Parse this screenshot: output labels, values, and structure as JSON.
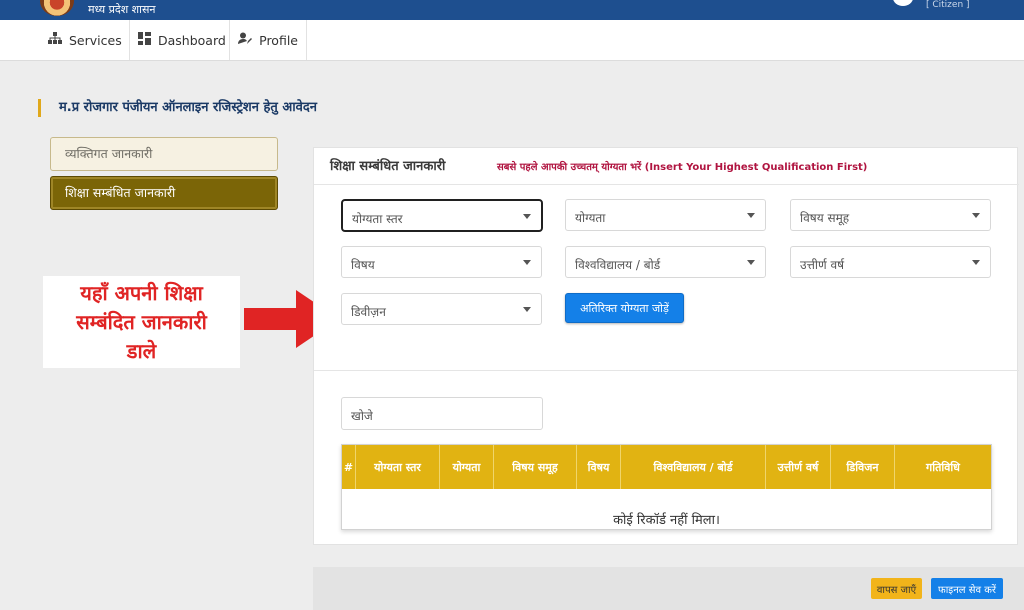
{
  "header": {
    "govt_name": "मध्य प्रदेश शासन",
    "user_role": "[ Citizen ]"
  },
  "nav": {
    "items": [
      {
        "label": "Services",
        "icon": "sitemap-icon"
      },
      {
        "label": "Dashboard",
        "icon": "dashboard-icon"
      },
      {
        "label": "Profile",
        "icon": "user-edit-icon"
      }
    ]
  },
  "page": {
    "heading": "म.प्र रोजगार पंजीयन ऑनलाइन रजिस्ट्रेशन हेतु आवेदन"
  },
  "sidebar": {
    "items": [
      {
        "label": "व्यक्तिगत जानकारी",
        "active": false
      },
      {
        "label": "शिक्षा सम्बंधित जानकारी",
        "active": true
      }
    ]
  },
  "annotation": {
    "line1": "यहाँ अपनी शिक्षा",
    "line2": "सम्बंदित जानकारी",
    "line3": "डाले",
    "arrow_color": "#e02424"
  },
  "form": {
    "title": "शिक्षा सम्बंधित जानकारी",
    "hint": "सबसे पहले आपकी उच्चतम् योग्यता भरें (Insert Your Highest Qualification First)",
    "fields": {
      "qualification_level": "योग्यता स्तर",
      "qualification": "योग्यता",
      "subject_group": "विषय समूह",
      "subject": "विषय",
      "university_board": "विश्वविद्यालय / बोर्ड",
      "passing_year": "उत्तीर्ण वर्ष",
      "division": "डिवीज़न"
    },
    "add_button": "अतिरिक्त योग्यता जोड़ें"
  },
  "search": {
    "placeholder": "खोजे"
  },
  "table": {
    "columns": [
      "#",
      "योग्यता स्तर",
      "योग्यता",
      "विषय समूह",
      "विषय",
      "विश्वविद्यालय / बोर्ड",
      "उत्तीर्ण वर्ष",
      "डिविजन",
      "गतिविधि"
    ],
    "empty_message": "कोई रिकॉर्ड नहीं मिला।",
    "header_color": "#e1b312"
  },
  "footer": {
    "back_button": "वापस जाएँ",
    "save_button": "फाइनल सेव करें"
  },
  "colors": {
    "header_blue": "#1e4f8f",
    "active_tab": "#7b6507",
    "primary_button": "#1480e8",
    "warning_button": "#f2b41a",
    "hint_text": "#b01440"
  }
}
